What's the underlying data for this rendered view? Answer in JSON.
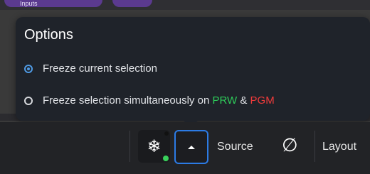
{
  "background_strip": {
    "chip_text": "Inputs"
  },
  "popover": {
    "title": "Options",
    "options": [
      {
        "label": "Freeze current selection",
        "selected": true
      },
      {
        "label_prefix": "Freeze selection simultaneously on ",
        "prw": "PRW",
        "amp": " & ",
        "pgm": "PGM",
        "selected": false
      }
    ]
  },
  "toolbar": {
    "freeze_icon": "snowflake-icon",
    "freeze_glyph": "❄",
    "caret_icon": "caret-up-icon",
    "source_label": "Source",
    "null_icon": "empty-set-icon",
    "null_glyph": "∅",
    "layout_label": "Layout"
  },
  "colors": {
    "accent": "#2c7be5",
    "radio_selected": "#4f9ae3",
    "prw": "#2ecc5a",
    "pgm": "#ef3b3b",
    "status_dot": "#39d15b"
  }
}
